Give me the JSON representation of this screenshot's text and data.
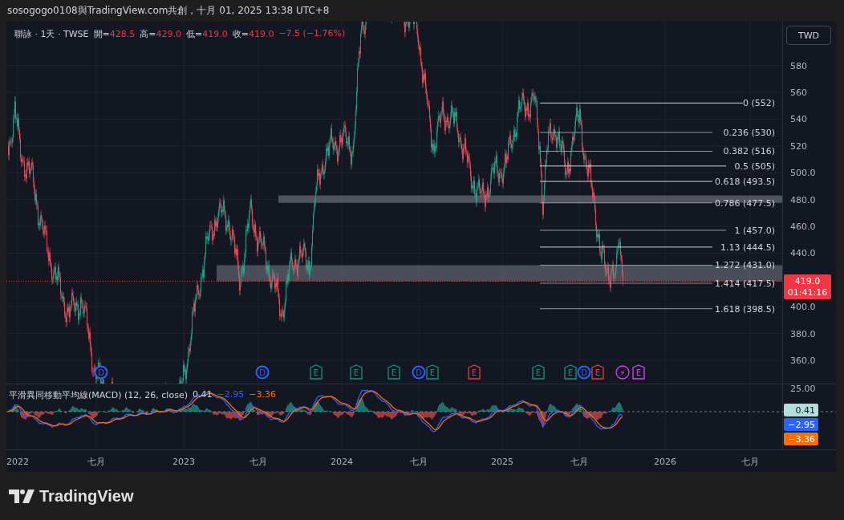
{
  "header": {
    "title": "sosogogo0108與TradingView.com共創，十月 01, 2025 13:38 UTC+8"
  },
  "legend": {
    "symbol": "聯詠 · 1天 · TWSE",
    "ohlc": [
      {
        "label": "開=",
        "value": "428.5"
      },
      {
        "label": "高=",
        "value": "429.0"
      },
      {
        "label": "低=",
        "value": "419.0"
      },
      {
        "label": "收=",
        "value": "419.0"
      }
    ],
    "change": "−7.5 (−1.76%)"
  },
  "currency_button": {
    "label": "TWD"
  },
  "price_axis": [
    "580",
    "560",
    "540",
    "520",
    "500.0",
    "480.0",
    "460.0",
    "440.0",
    "400.0",
    "380.0",
    "360.0"
  ],
  "last_price": {
    "price": "419.0",
    "countdown": "01:41:16"
  },
  "fibonacci": [
    "0 (552)",
    "0.236 (530)",
    "0.382 (516)",
    "0.5 (505)",
    "0.618 (493.5)",
    "0.786 (477.5)",
    "1 (457.0)",
    "1.13 (444.5)",
    "1.272 (431.0)",
    "1.414 (417.5)",
    "1.618 (398.5)"
  ],
  "events": [
    {
      "kind": "dividend",
      "label": "D",
      "color": "#2962ff"
    },
    {
      "kind": "dividend",
      "label": "D",
      "color": "#2962ff"
    },
    {
      "kind": "earnings",
      "label": "E",
      "color": "#089981"
    },
    {
      "kind": "earnings",
      "label": "E",
      "color": "#089981"
    },
    {
      "kind": "earnings",
      "label": "E",
      "color": "#089981"
    },
    {
      "kind": "dividend",
      "label": "D",
      "color": "#2962ff"
    },
    {
      "kind": "earnings",
      "label": "E",
      "color": "#089981"
    },
    {
      "kind": "earnings",
      "label": "E",
      "color": "#f23645"
    },
    {
      "kind": "earnings",
      "label": "E",
      "color": "#089981"
    },
    {
      "kind": "earnings",
      "label": "E",
      "color": "#089981"
    },
    {
      "kind": "dividend",
      "label": "D",
      "color": "#2962ff"
    },
    {
      "kind": "earnings",
      "label": "E",
      "color": "#f23645"
    },
    {
      "kind": "split",
      "label": "⚡",
      "color": "#e040fb"
    },
    {
      "kind": "earnings",
      "label": "E",
      "color": "#e040fb"
    }
  ],
  "macd": {
    "title": "平滑異同移動平均線(MACD) (12, 26, close)",
    "values": [
      {
        "text": "0.41",
        "color": "#d1d4dc"
      },
      {
        "text": "−2.95",
        "color": "#2962ff"
      },
      {
        "text": "−3.36",
        "color": "#ff6d00"
      }
    ],
    "axis_label": "25.00",
    "tags": [
      {
        "text": "0.41",
        "color": "#b2dfdb"
      },
      {
        "text": "−2.95",
        "color": "#2962ff"
      },
      {
        "text": "−3.36",
        "color": "#ff6d00"
      }
    ]
  },
  "time_axis": [
    "2022",
    "七月",
    "2023",
    "七月",
    "2024",
    "七月",
    "2025",
    "七月",
    "2026",
    "七月"
  ],
  "footer": {
    "brand": "TradingView"
  }
}
